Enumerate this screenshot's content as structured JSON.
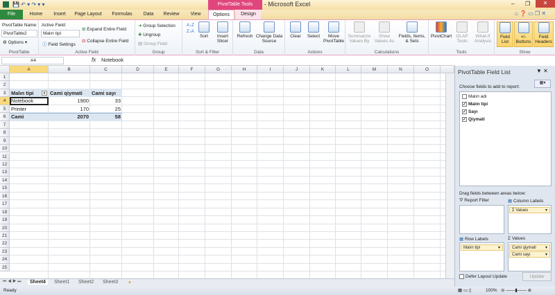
{
  "window": {
    "title": "Book1 - Microsoft Excel",
    "context_tab": "PivotTable Tools"
  },
  "tabs": [
    "File",
    "Home",
    "Insert",
    "Page Layout",
    "Formulas",
    "Data",
    "Review",
    "View",
    "Options",
    "Design"
  ],
  "active_tab": "Options",
  "ribbon": {
    "pivottable": {
      "name_label": "PivotTable Name:",
      "name_value": "PivotTable2",
      "options": "Options",
      "group": "PivotTable"
    },
    "active_field": {
      "label": "Active Field:",
      "value": "Malın tipi",
      "field_settings": "Field Settings",
      "expand": "Expand Entire Field",
      "collapse": "Collapse Entire Field",
      "group": "Active Field"
    },
    "group": {
      "group_selection": "Group Selection",
      "ungroup": "Ungroup",
      "group_field": "Group Field",
      "group": "Group"
    },
    "sort": {
      "sort": "Sort",
      "insert_slicer": "Insert Slicer",
      "group": "Sort & Filter"
    },
    "data": {
      "refresh": "Refresh",
      "change_source": "Change Data Source",
      "group": "Data"
    },
    "actions": {
      "clear": "Clear",
      "select": "Select",
      "move": "Move PivotTable",
      "group": "Actions"
    },
    "calculations": {
      "summarize": "Summarize Values By",
      "show_values": "Show Values As",
      "fields_items": "Fields, Items, & Sets",
      "group": "Calculations"
    },
    "tools": {
      "pivotchart": "PivotChart",
      "olap": "OLAP Tools",
      "whatif": "What-If Analysis",
      "group": "Tools"
    },
    "show": {
      "field_list": "Field List",
      "buttons": "+/- Buttons",
      "headers": "Field Headers",
      "group": "Show"
    }
  },
  "formula_bar": {
    "name_box": "A4",
    "fx": "fx",
    "value": "Notebook"
  },
  "columns": [
    "A",
    "B",
    "C",
    "D",
    "E",
    "F",
    "G",
    "H",
    "I",
    "J",
    "K",
    "L",
    "M",
    "N",
    "O"
  ],
  "rows": [
    "1",
    "2",
    "3",
    "4",
    "5",
    "6",
    "7",
    "8",
    "9",
    "10",
    "11",
    "12",
    "13",
    "14",
    "15",
    "16",
    "17",
    "18",
    "19",
    "20",
    "21",
    "22",
    "23",
    "24",
    "25"
  ],
  "pivot": {
    "headers": [
      "Malın tipi",
      "Cami qiymati",
      "Cami sayı"
    ],
    "rows": [
      [
        "Notebook",
        "1900",
        "33"
      ],
      [
        "Printer",
        "170",
        "25"
      ]
    ],
    "total": [
      "Cami",
      "2070",
      "58"
    ]
  },
  "sheets": [
    "Sheet4",
    "Sheet1",
    "Sheet2",
    "Sheet3"
  ],
  "active_sheet": "Sheet4",
  "status": {
    "ready": "Ready",
    "zoom": "100%"
  },
  "field_list": {
    "title": "PivotTable Field List",
    "choose": "Choose fields to add to report:",
    "fields": [
      {
        "name": "Malın adı",
        "checked": false
      },
      {
        "name": "Malın tipi",
        "checked": true
      },
      {
        "name": "Sayı",
        "checked": true
      },
      {
        "name": "Qiymati",
        "checked": true
      }
    ],
    "drag": "Drag fields between areas below:",
    "report_filter": "Report Filter",
    "column_labels": "Column Labels",
    "row_labels": "Row Labels",
    "values": "Values",
    "column_items": [
      "Values"
    ],
    "row_items": [
      "Malın tipi"
    ],
    "value_items": [
      "Cami qiymati",
      "Cami sayı"
    ],
    "defer": "Defer Layout Update",
    "update": "Update"
  }
}
